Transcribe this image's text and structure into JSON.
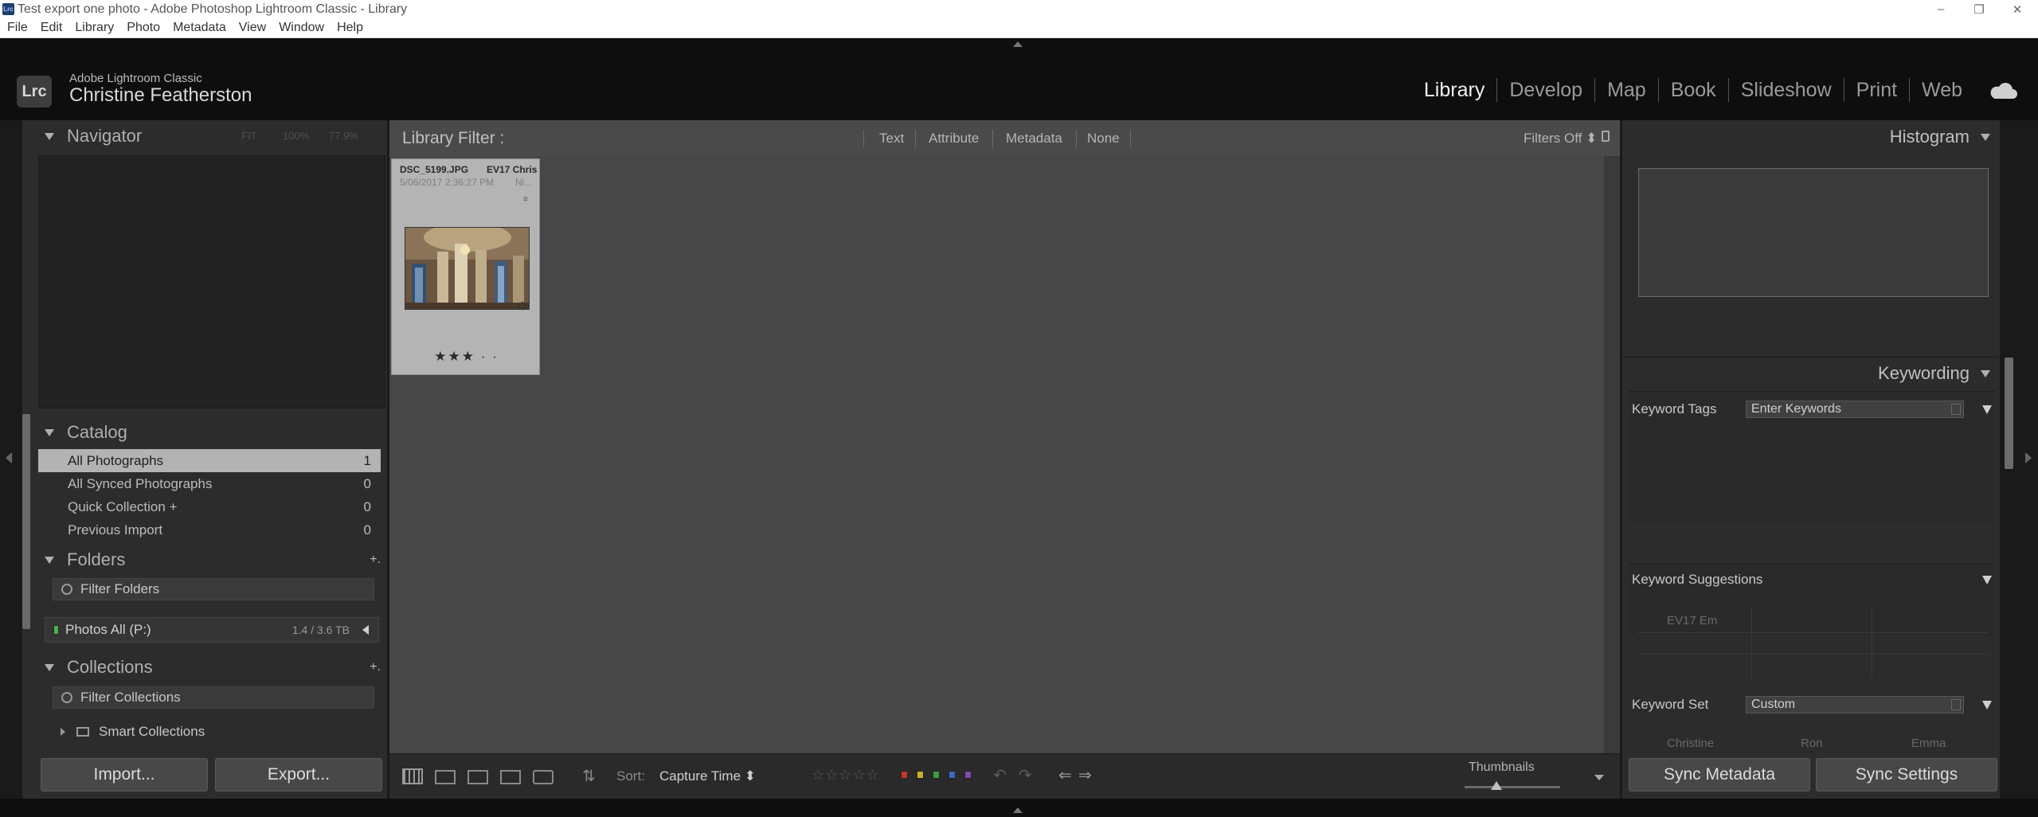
{
  "window": {
    "title": "Test export one photo - Adobe Photoshop Lightroom Classic - Library",
    "app_badge": "Lrc",
    "controls": [
      "–",
      "❐",
      "✕"
    ]
  },
  "menu": [
    "File",
    "Edit",
    "Library",
    "Photo",
    "Metadata",
    "View",
    "Window",
    "Help"
  ],
  "identity": {
    "logo": "Lrc",
    "product": "Adobe Lightroom Classic",
    "user": "Christine Featherston"
  },
  "modules": [
    {
      "label": "Library",
      "active": true
    },
    {
      "label": "Develop",
      "active": false
    },
    {
      "label": "Map",
      "active": false
    },
    {
      "label": "Book",
      "active": false
    },
    {
      "label": "Slideshow",
      "active": false
    },
    {
      "label": "Print",
      "active": false
    },
    {
      "label": "Web",
      "active": false
    }
  ],
  "navigator": {
    "title": "Navigator",
    "zoom": [
      "FIT",
      "100%",
      "77.9%"
    ]
  },
  "catalog": {
    "title": "Catalog",
    "items": [
      {
        "label": "All Photographs",
        "count": "1",
        "selected": true
      },
      {
        "label": "All Synced Photographs",
        "count": "0"
      },
      {
        "label": "Quick Collection  +",
        "count": "0"
      },
      {
        "label": "Previous Import",
        "count": "0"
      }
    ]
  },
  "folders": {
    "title": "Folders",
    "plus": "+.",
    "filter_placeholder": "Filter Folders",
    "volume": {
      "name": "Photos All (P:)",
      "usage": "1.4 / 3.6 TB"
    }
  },
  "collections": {
    "title": "Collections",
    "plus": "+.",
    "filter_placeholder": "Filter Collections",
    "smart": "Smart Collections"
  },
  "buttons": {
    "import": "Import...",
    "export": "Export...",
    "sync_metadata": "Sync Metadata",
    "sync_settings": "Sync Settings"
  },
  "library_filter": {
    "title": "Library Filter :",
    "options": [
      "Text",
      "Attribute",
      "Metadata",
      "None"
    ],
    "filters_off": "Filters Off ⬍"
  },
  "thumbnail": {
    "filename": "DSC_5199.JPG",
    "meta": "EV17 Chris",
    "date": "5/06/2017 2:36:27 PM",
    "camera": "Ni...",
    "rating": "★★★ · ·",
    "rating_value": 3
  },
  "toolbar": {
    "sort_label": "Sort:",
    "sort_value": "Capture Time ⬍",
    "rating_filter": "☆☆☆☆☆",
    "thumbnails_label": "Thumbnails",
    "color_labels": [
      "#c0392b",
      "#c9b02a",
      "#3f9a3f",
      "#3a6ac0",
      "#7b4bb0"
    ],
    "nav_arrows": [
      "⇐",
      "⇒"
    ],
    "rotate": [
      "↶",
      "↷"
    ]
  },
  "histogram": {
    "title": "Histogram"
  },
  "keywording": {
    "title": "Keywording",
    "tags_label": "Keyword Tags",
    "tags_value": "Enter Keywords",
    "suggestions_label": "Keyword Suggestions",
    "suggestions": [
      "EV17 Em"
    ],
    "set_label": "Keyword Set",
    "set_value": "Custom",
    "set_items": [
      "Christine",
      "Ron",
      "Emma"
    ]
  },
  "colors": {
    "accent_selected": "#b3b3b3",
    "panel": "#2c2c2c",
    "grid": "#474747"
  }
}
